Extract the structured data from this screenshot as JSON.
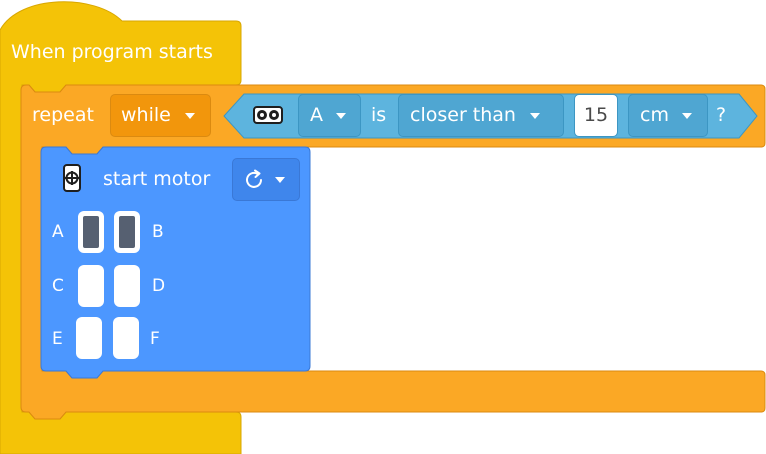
{
  "hat_block": {
    "label": "When program starts"
  },
  "repeat_block": {
    "label": "repeat",
    "mode": "while"
  },
  "condition": {
    "sensor_port": "A",
    "is_label": "is",
    "comparison": "closer than",
    "value": "15",
    "unit": "cm",
    "question": "?",
    "sensor_icon": "distance-sensor-icon"
  },
  "motor_block": {
    "label": "start motor",
    "motor_icon": "motor-icon",
    "direction_icon": "clockwise-arrow-icon",
    "ports": [
      {
        "name": "A",
        "selected": true
      },
      {
        "name": "B",
        "selected": true
      },
      {
        "name": "C",
        "selected": false
      },
      {
        "name": "D",
        "selected": false
      },
      {
        "name": "E",
        "selected": false
      },
      {
        "name": "F",
        "selected": false
      }
    ]
  },
  "colors": {
    "hat_yellow": "#F4C307",
    "hat_border": "#D9A700",
    "control_orange": "#FBA825",
    "control_border": "#DB8A10",
    "control_dropdown": "#F2960C",
    "sensor_blue": "#5DB4DE",
    "sensor_border": "#3C96C3",
    "motor_blue": "#4C97FF",
    "motor_border": "#3A78D6",
    "motor_dropdown": "#3F86EC"
  }
}
